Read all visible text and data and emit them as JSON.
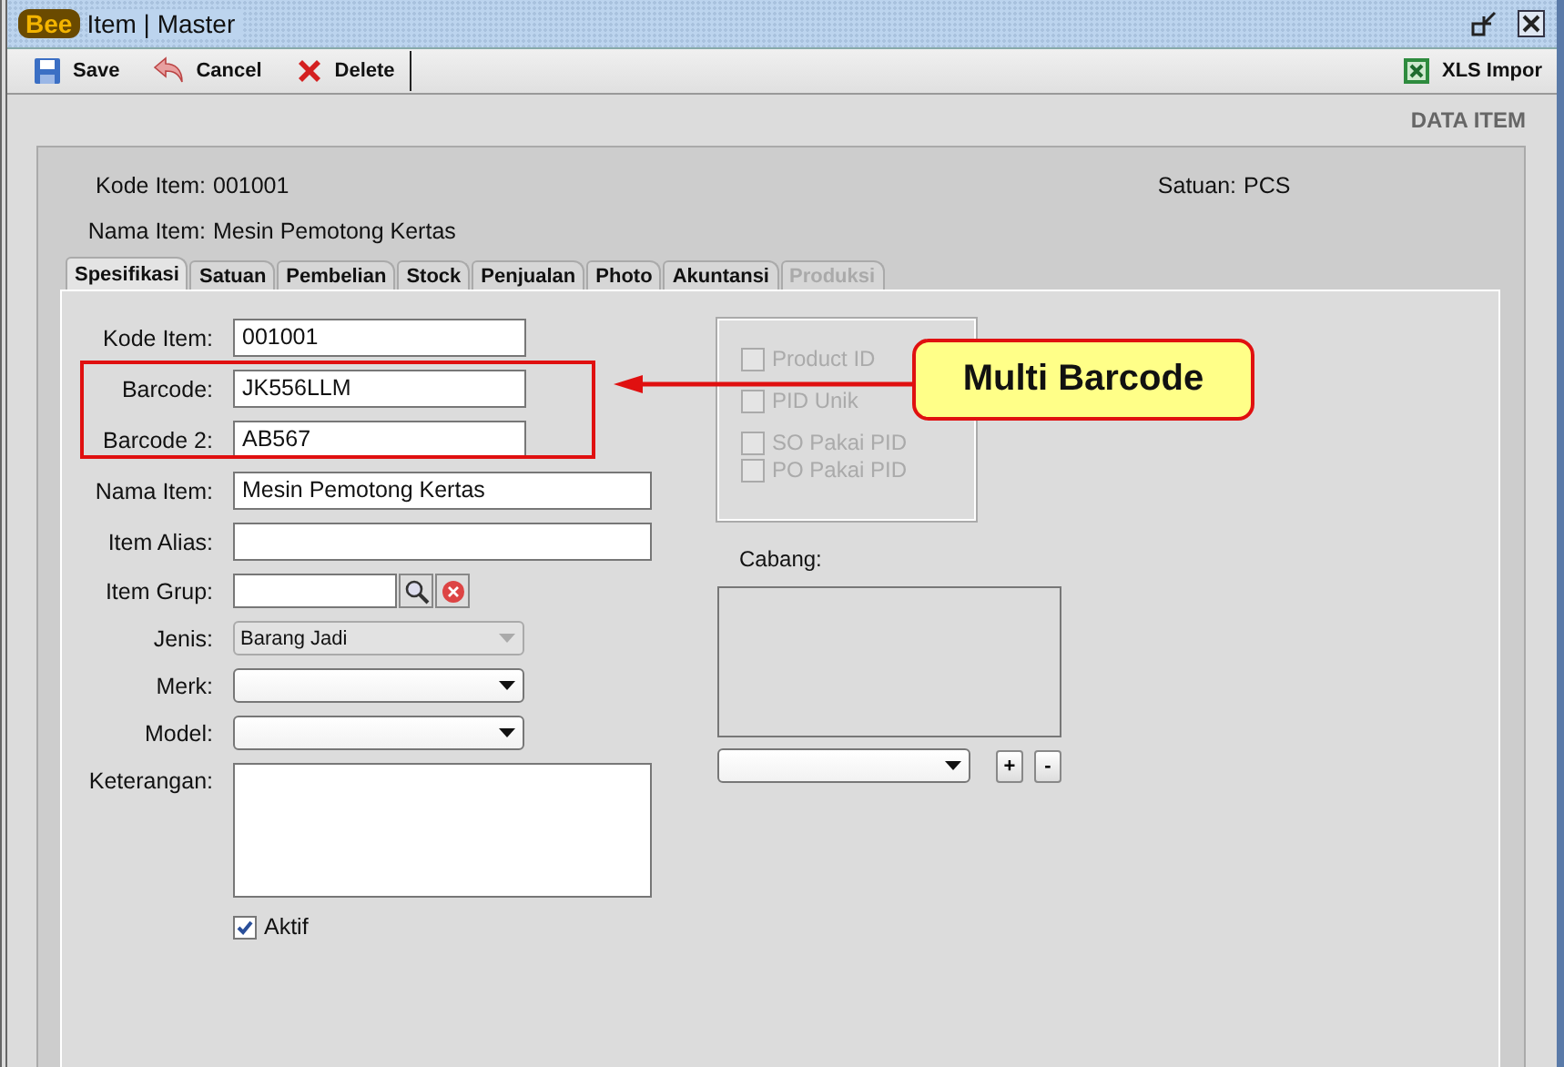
{
  "window": {
    "logo": "Bee",
    "title": "Item | Master"
  },
  "toolbar": [
    {
      "kind": "save",
      "label": "Save"
    },
    {
      "kind": "cancel",
      "label": "Cancel"
    },
    {
      "kind": "delete",
      "label": "Delete"
    }
  ],
  "toolbar_right": {
    "kind": "excel",
    "label": "XLS Impor"
  },
  "section_title": "DATA ITEM",
  "header": {
    "kode_label": "Kode Item:",
    "kode_value": "001001",
    "nama_label": "Nama Item:",
    "nama_value": "Mesin Pemotong Kertas",
    "satuan_label": "Satuan:",
    "satuan_value": "PCS"
  },
  "tabs": [
    {
      "label": "Spesifikasi",
      "selected": true,
      "disabled": false
    },
    {
      "label": "Satuan",
      "selected": false,
      "disabled": false
    },
    {
      "label": "Pembelian",
      "selected": false,
      "disabled": false
    },
    {
      "label": "Stock",
      "selected": false,
      "disabled": false
    },
    {
      "label": "Penjualan",
      "selected": false,
      "disabled": false
    },
    {
      "label": "Photo",
      "selected": false,
      "disabled": false
    },
    {
      "label": "Akuntansi",
      "selected": false,
      "disabled": false
    },
    {
      "label": "Produksi",
      "selected": false,
      "disabled": true
    }
  ],
  "form": [
    {
      "kind": "text",
      "label": "Kode Item:",
      "value": "001001"
    },
    {
      "kind": "text",
      "label": "Barcode:",
      "value": "JK556LLM"
    },
    {
      "kind": "text",
      "label": "Barcode 2:",
      "value": "AB567"
    },
    {
      "kind": "widetext",
      "label": "Nama Item:",
      "value": "Mesin Pemotong Kertas"
    },
    {
      "kind": "widetext",
      "label": "Item Alias:"
    },
    {
      "kind": "lookup",
      "label": "Item Grup:"
    },
    {
      "kind": "select",
      "label": "Jenis:",
      "value": "Barang Jadi",
      "disabled": true
    },
    {
      "kind": "select",
      "label": "Merk:",
      "disabled": false
    },
    {
      "kind": "select",
      "label": "Model:",
      "disabled": false
    },
    {
      "kind": "textarea",
      "label": "Keterangan:"
    }
  ],
  "aktif": {
    "label": "Aktif",
    "checked": true
  },
  "pid_options": [
    {
      "label": "Product ID",
      "checked": false,
      "disabled": true
    },
    {
      "label": "PID Unik",
      "checked": false,
      "disabled": true
    },
    {
      "label": "SO Pakai PID",
      "checked": false,
      "disabled": true
    },
    {
      "label": "PO Pakai PID",
      "checked": false,
      "disabled": true
    }
  ],
  "cabang": {
    "label": "Cabang:",
    "add": "+",
    "remove": "-"
  },
  "annotation": {
    "text": "Multi Barcode"
  }
}
